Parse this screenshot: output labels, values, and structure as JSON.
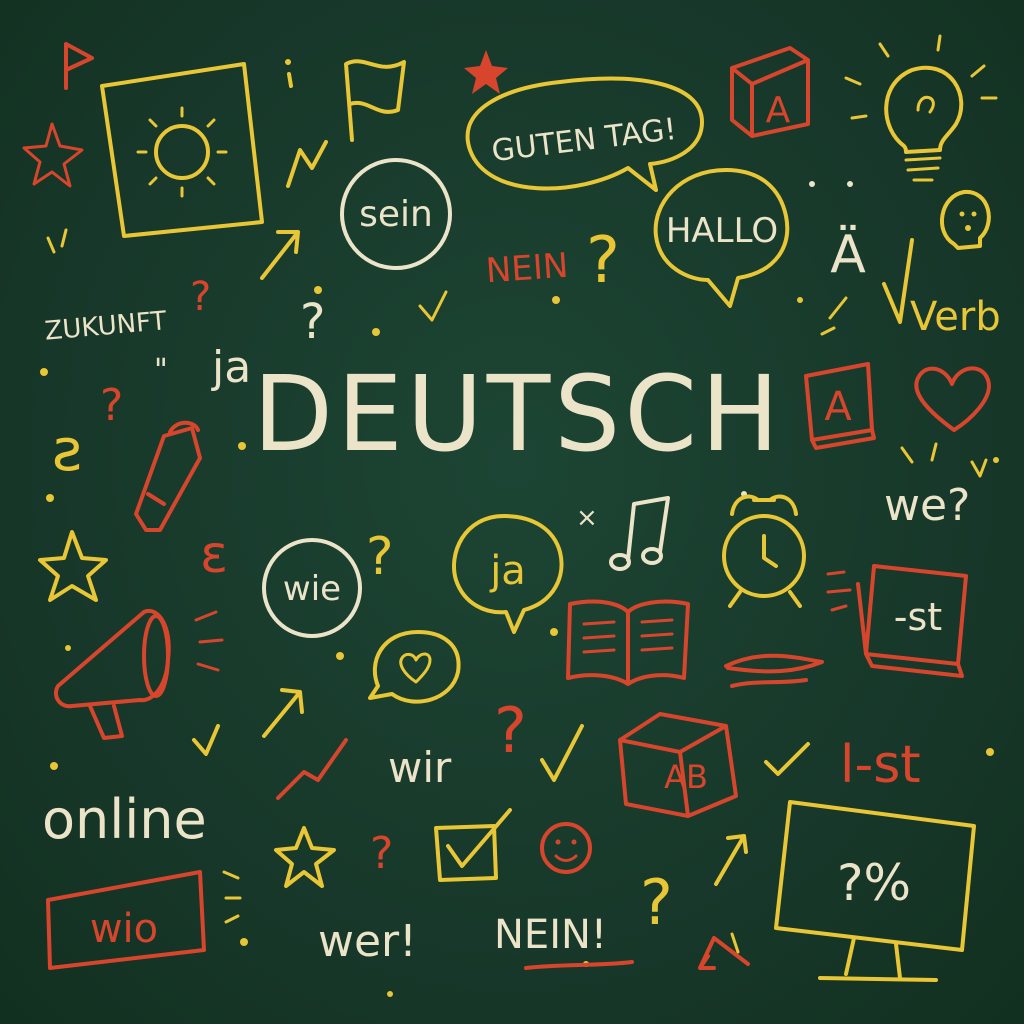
{
  "title": "DEUTSCH",
  "words": {
    "guten_tag": "GUTEN TAG!",
    "sein": "sein",
    "hallo": "HALLO",
    "nein_top": "NEIN",
    "umlaut": "Ä",
    "verb": "Verb",
    "zukunft": "ZUKUNFT",
    "ja_left": "ja",
    "we": "we?",
    "wie": "wie",
    "ja_bubble": "ja",
    "suffix_card": "-st",
    "suffix_right": "l-st",
    "wir": "wir",
    "online": "online",
    "wer": "wer!",
    "nein_bottom": "NEIN!",
    "wio": "wio",
    "monitor": "?%",
    "cube_top": "A",
    "cube_book": "A",
    "cube_ab": "AB",
    "epsilon": "ε"
  },
  "icons": [
    "sun-frame-icon",
    "flag-icon",
    "lightbulb-icon",
    "letter-cube-icon",
    "star-icon",
    "crayon-icon",
    "megaphone-icon",
    "alarm-clock-icon",
    "open-book-icon",
    "heart-icon",
    "music-note-icon",
    "checkbox-icon",
    "smiley-icon",
    "monitor-icon",
    "speech-bubble-icon",
    "arrow-icon"
  ],
  "colors": {
    "background": "#173a2c",
    "cream": "#ece4c8",
    "yellow": "#e8c636",
    "red": "#d7462c"
  }
}
